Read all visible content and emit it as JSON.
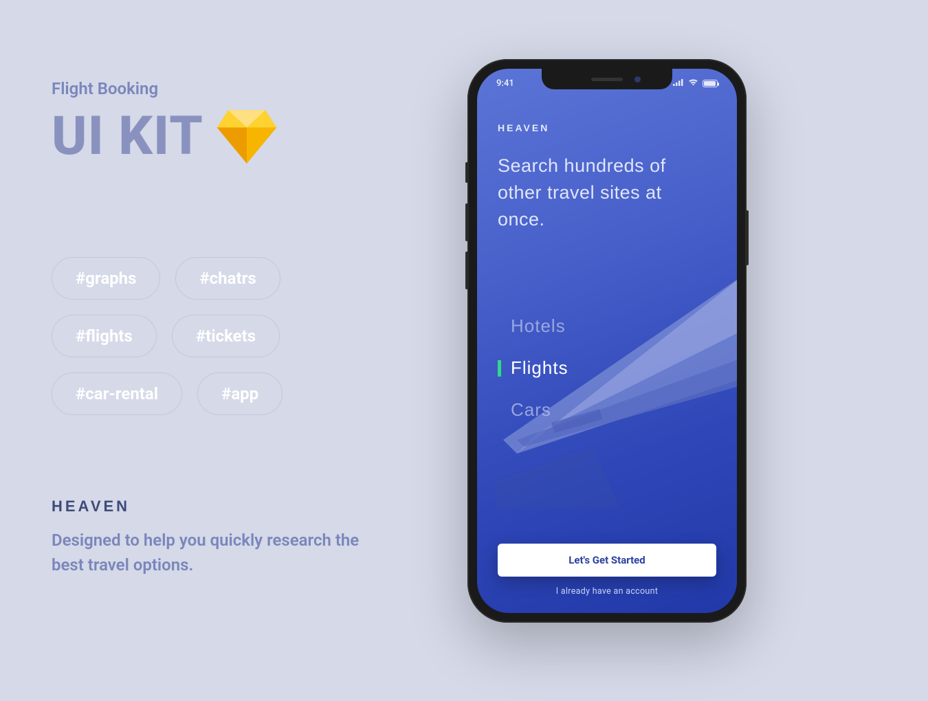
{
  "promo": {
    "subtitle": "Flight Booking",
    "title": "UI KIT",
    "tags": [
      "#graphs",
      "#chatrs",
      "#flights",
      "#tickets",
      "#car-rental",
      "#app"
    ],
    "brand": "HEAVEN",
    "description": "Designed to help you quickly research the best travel options."
  },
  "phone": {
    "status": {
      "time": "9:41"
    },
    "brand": "HEAVEN",
    "headline": "Search hundreds of other travel sites at once.",
    "categories": [
      {
        "label": "Hotels",
        "active": false
      },
      {
        "label": "Flights",
        "active": true
      },
      {
        "label": "Cars",
        "active": false
      }
    ],
    "cta": "Let's Get Started",
    "alt_link": "I already have an account"
  }
}
